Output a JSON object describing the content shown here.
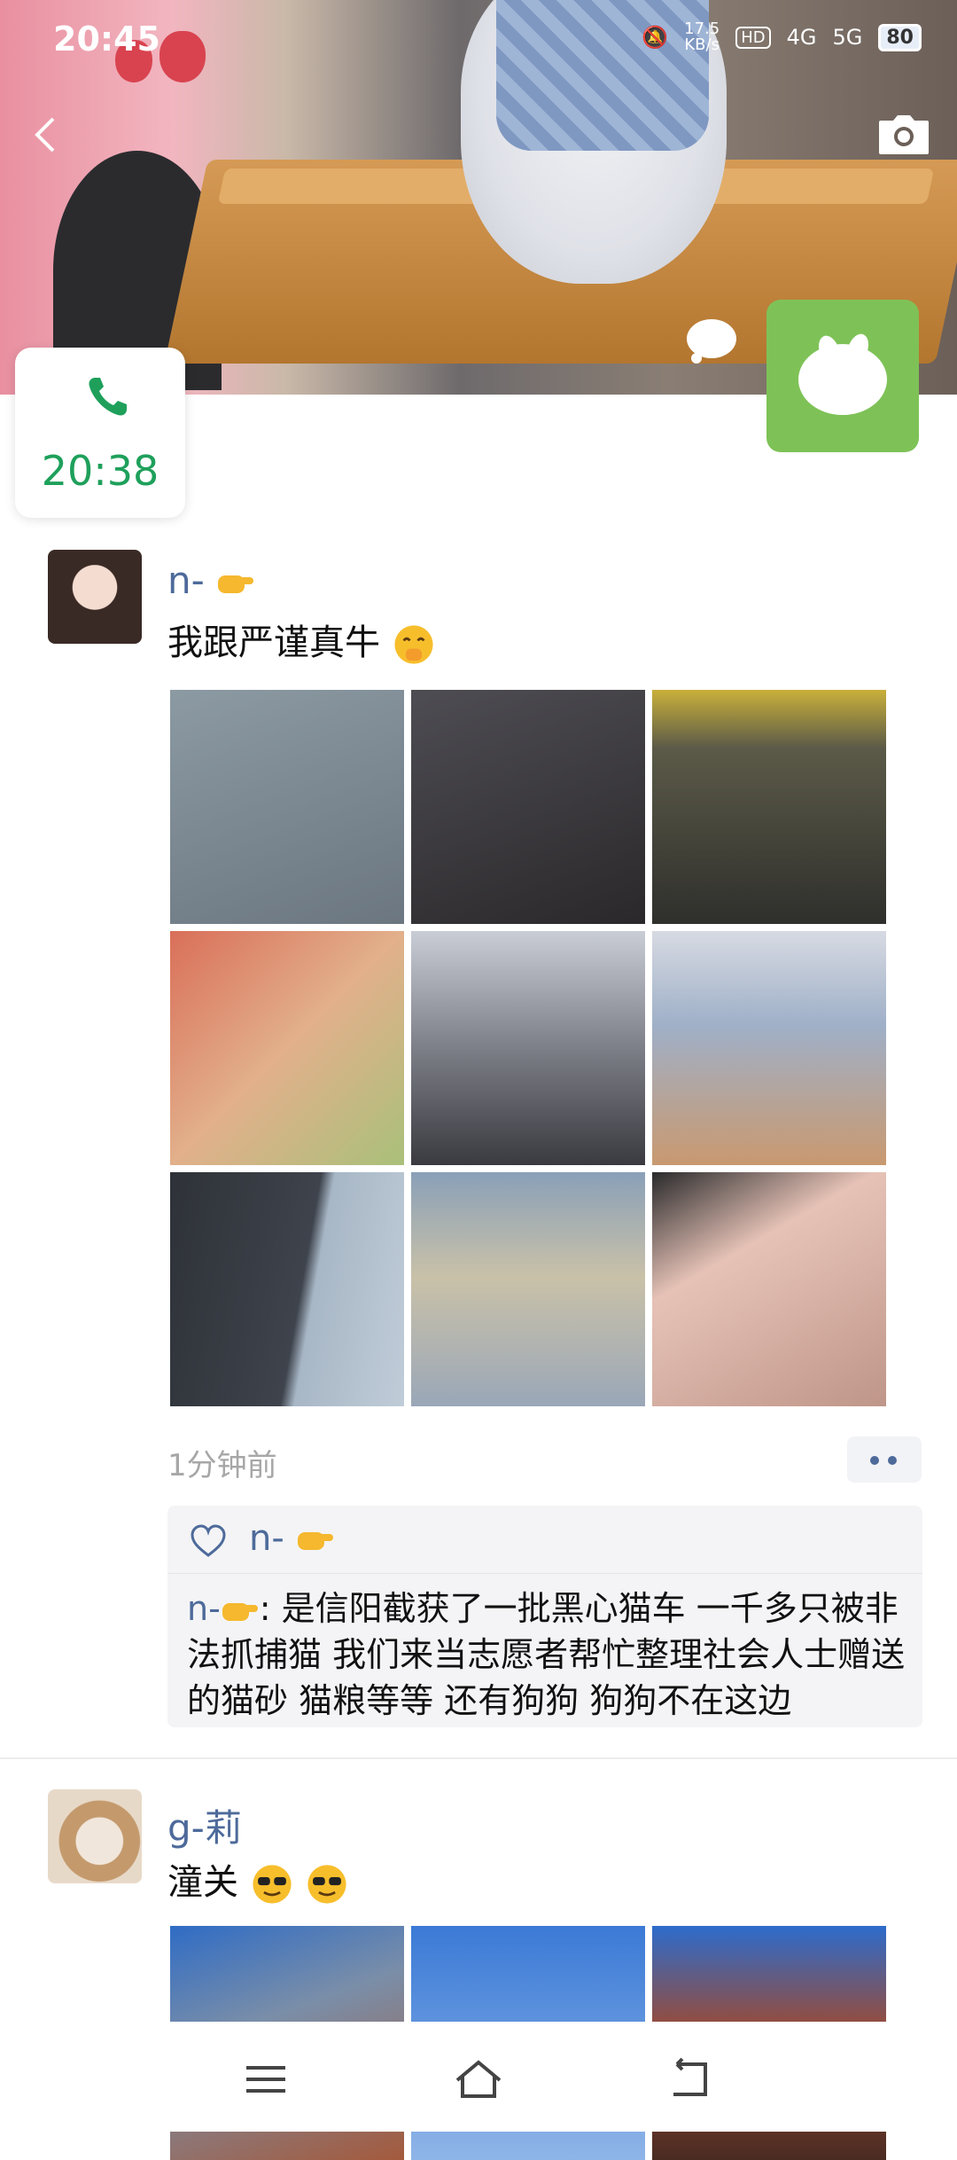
{
  "status_bar": {
    "time": "20:45",
    "net_speed": "17.5",
    "net_unit": "KB/s",
    "signal1": "4G",
    "signal2": "5G",
    "battery": "80"
  },
  "call_card": {
    "time": "20:38",
    "color": "#1ea05b"
  },
  "posts": [
    {
      "nickname": "n-",
      "text": "我跟严谨真牛",
      "timestamp": "1分钟前",
      "likes": [
        "n-"
      ],
      "comment": {
        "author": "n-",
        "text": ": 是信阳截获了一批黑心猫车 一千多只被非法抓捕猫 我们来当志愿者帮忙整理社会人士赠送的猫砂 猫粮等等 还有狗狗 狗狗不在这边"
      },
      "images": [
        {
          "name": "cats-in-cages-photo",
          "colors": [
            "#7f8c96",
            "#5f6c78"
          ]
        },
        {
          "name": "volunteers-dark-warehouse-photo",
          "colors": [
            "#4a4a50",
            "#2c2a2c"
          ]
        },
        {
          "name": "warehouse-tables-photo",
          "colors": [
            "#5b5a48",
            "#2f2f2c"
          ]
        },
        {
          "name": "food-boxes-photo",
          "colors": [
            "#d96f59",
            "#a9c07a"
          ]
        },
        {
          "name": "volunteers-supplies-room-photo",
          "colors": [
            "#9ca3b0",
            "#6a6c74"
          ]
        },
        {
          "name": "supply-piles-photo",
          "colors": [
            "#b6b9c3",
            "#c99970"
          ]
        },
        {
          "name": "pants-closeup-photo",
          "colors": [
            "#3e434c",
            "#a8b7c6"
          ]
        },
        {
          "name": "cat-litter-bags-photo",
          "colors": [
            "#c9c1a8",
            "#8aa0b8"
          ]
        },
        {
          "name": "fist-hand-photo",
          "colors": [
            "#e6c2b6",
            "#bf9689"
          ]
        }
      ]
    },
    {
      "nickname": "g-莉",
      "text": "潼关",
      "images": [
        {
          "name": "ancient-building-photo",
          "colors": [
            "#2f6cc5",
            "#a45a3c"
          ]
        },
        {
          "name": "sky-photo",
          "colors": [
            "#3b7ad6",
            "#8fb5e8"
          ]
        },
        {
          "name": "pagoda-tower-photo",
          "colors": [
            "#2d6ccc",
            "#9b4a34"
          ]
        }
      ]
    }
  ],
  "colors": {
    "nickname": "#4d6a9a",
    "timestamp": "#a7a7a7"
  }
}
